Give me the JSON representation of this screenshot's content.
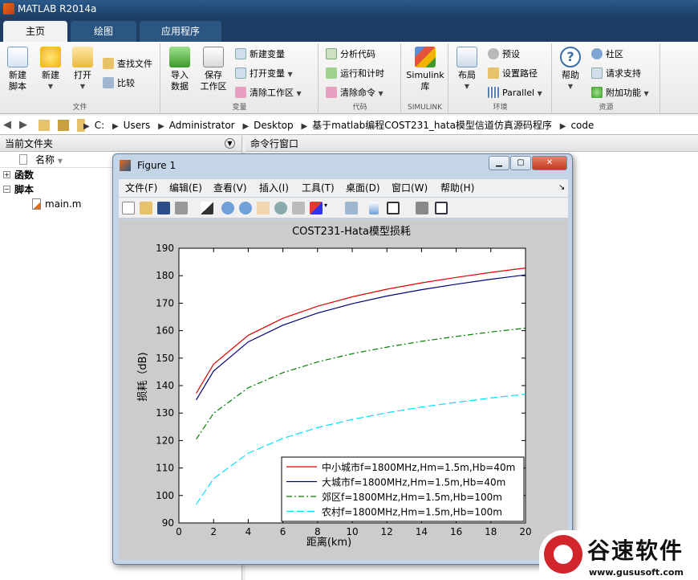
{
  "app": {
    "title": "MATLAB R2014a"
  },
  "tabs": [
    {
      "label": "主页"
    },
    {
      "label": "绘图"
    },
    {
      "label": "应用程序"
    }
  ],
  "ribbon": {
    "file": {
      "group": "文件",
      "new_script": "新建\n脚本",
      "new": "新建",
      "open": "打开",
      "find_files": "查找文件",
      "compare": "比较"
    },
    "variable": {
      "group": "变量",
      "import": "导入\n数据",
      "save_ws": "保存\n工作区",
      "new_var": "新建变量",
      "open_var": "打开变量",
      "clear_ws": "清除工作区"
    },
    "code": {
      "group": "代码",
      "analyze": "分析代码",
      "run_time": "运行和计时",
      "clear_cmd": "清除命令"
    },
    "simulink": {
      "group": "SIMULINK",
      "lib": "Simulink\n库"
    },
    "env": {
      "group": "环境",
      "layout": "布局",
      "prefs": "预设",
      "set_path": "设置路径",
      "parallel": "Parallel"
    },
    "resources": {
      "group": "资源",
      "help": "帮助",
      "community": "社区",
      "support": "请求支持",
      "addons": "附加功能"
    }
  },
  "address": {
    "crumbs": [
      "C:",
      "Users",
      "Administrator",
      "Desktop",
      "基于matlab编程COST231_hata模型信道仿真源码程序",
      "code"
    ]
  },
  "filepane": {
    "title": "当前文件夹",
    "col_name": "名称",
    "items": [
      "函数",
      "脚本",
      "main.m"
    ]
  },
  "cmdwin": {
    "title": "命令行窗口"
  },
  "figure": {
    "title": "Figure 1",
    "menus": [
      "文件(F)",
      "编辑(E)",
      "查看(V)",
      "插入(I)",
      "工具(T)",
      "桌面(D)",
      "窗口(W)",
      "帮助(H)"
    ]
  },
  "chart_data": {
    "type": "line",
    "title": "COST231-Hata模型损耗",
    "xlabel": "距离(km)",
    "ylabel": "损耗（dB)",
    "xlim": [
      0,
      20
    ],
    "ylim": [
      90,
      190
    ],
    "xticks": [
      0,
      2,
      4,
      6,
      8,
      10,
      12,
      14,
      16,
      18,
      20
    ],
    "yticks": [
      90,
      100,
      110,
      120,
      130,
      140,
      150,
      160,
      170,
      180,
      190
    ],
    "grid": false,
    "legend_position": "bottom-right",
    "x": [
      1,
      2,
      4,
      6,
      8,
      10,
      12,
      14,
      16,
      18,
      20
    ],
    "series": [
      {
        "name": "中小城市f=1800MHz,Hm=1.5m,Hb=40m",
        "color": "#e00000",
        "style": "solid",
        "values": [
          137.2,
          147.8,
          158.3,
          164.5,
          168.9,
          172.3,
          175.1,
          177.4,
          179.4,
          181.2,
          182.8
        ]
      },
      {
        "name": "大城市f=1800MHz,Hm=1.5m,Hb=40m",
        "color": "#000080",
        "style": "solid",
        "values": [
          134.8,
          145.3,
          155.9,
          162.0,
          166.4,
          169.8,
          172.6,
          174.9,
          176.9,
          178.7,
          180.3
        ]
      },
      {
        "name": "郊区f=1800MHz,Hm=1.5m,Hb=100m",
        "color": "#008000",
        "style": "dashdot",
        "values": [
          120.5,
          129.9,
          139.2,
          144.7,
          148.6,
          151.6,
          154.0,
          156.1,
          157.9,
          159.5,
          160.9
        ]
      },
      {
        "name": "农村f=1800MHz,Hm=1.5m,Hb=100m",
        "color": "#00e0ff",
        "style": "dashed",
        "values": [
          96.8,
          106.1,
          115.4,
          120.8,
          124.7,
          127.7,
          130.1,
          132.2,
          133.9,
          135.5,
          136.9
        ]
      }
    ]
  },
  "watermark": {
    "text": "谷速软件",
    "url": "www.gususoft.com"
  }
}
